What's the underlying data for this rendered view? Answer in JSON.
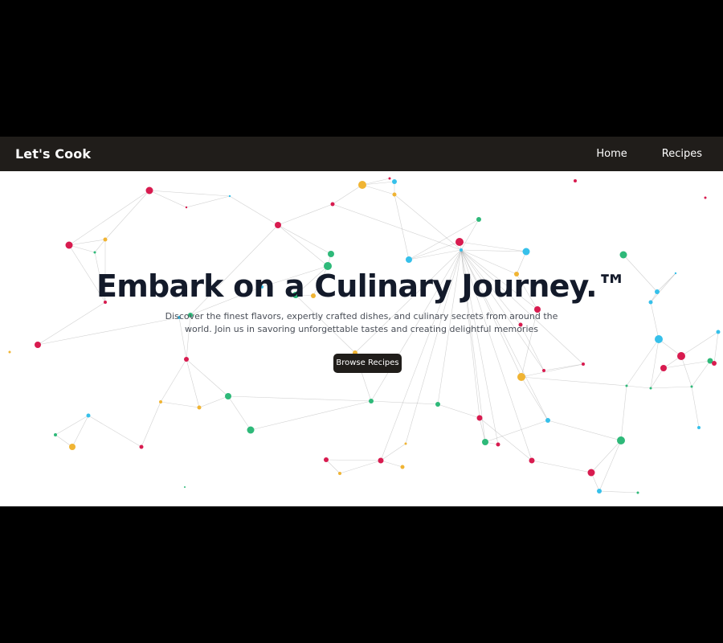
{
  "navbar": {
    "brand": "Let's Cook",
    "links": [
      {
        "label": "Home"
      },
      {
        "label": "Recipes"
      }
    ]
  },
  "hero": {
    "title": "Embark on a Culinary Journey.™",
    "subtitle": "Discover the finest flavors, expertly crafted dishes, and culinary secrets from around the world. Join us in savoring unforgettable tastes and creating delightful memories",
    "cta_label": "Browse Recipes"
  },
  "colors": {
    "page_background": "#000000",
    "navbar_background": "#201d1a",
    "hero_background": "#ffffff",
    "title": "#131a2a",
    "subtitle": "#4a4f58",
    "button_background": "#201d1a",
    "button_text": "#ffffff",
    "particle_palette": [
      "#d81b4f",
      "#f0b433",
      "#36c0ea",
      "#2eb979"
    ]
  }
}
